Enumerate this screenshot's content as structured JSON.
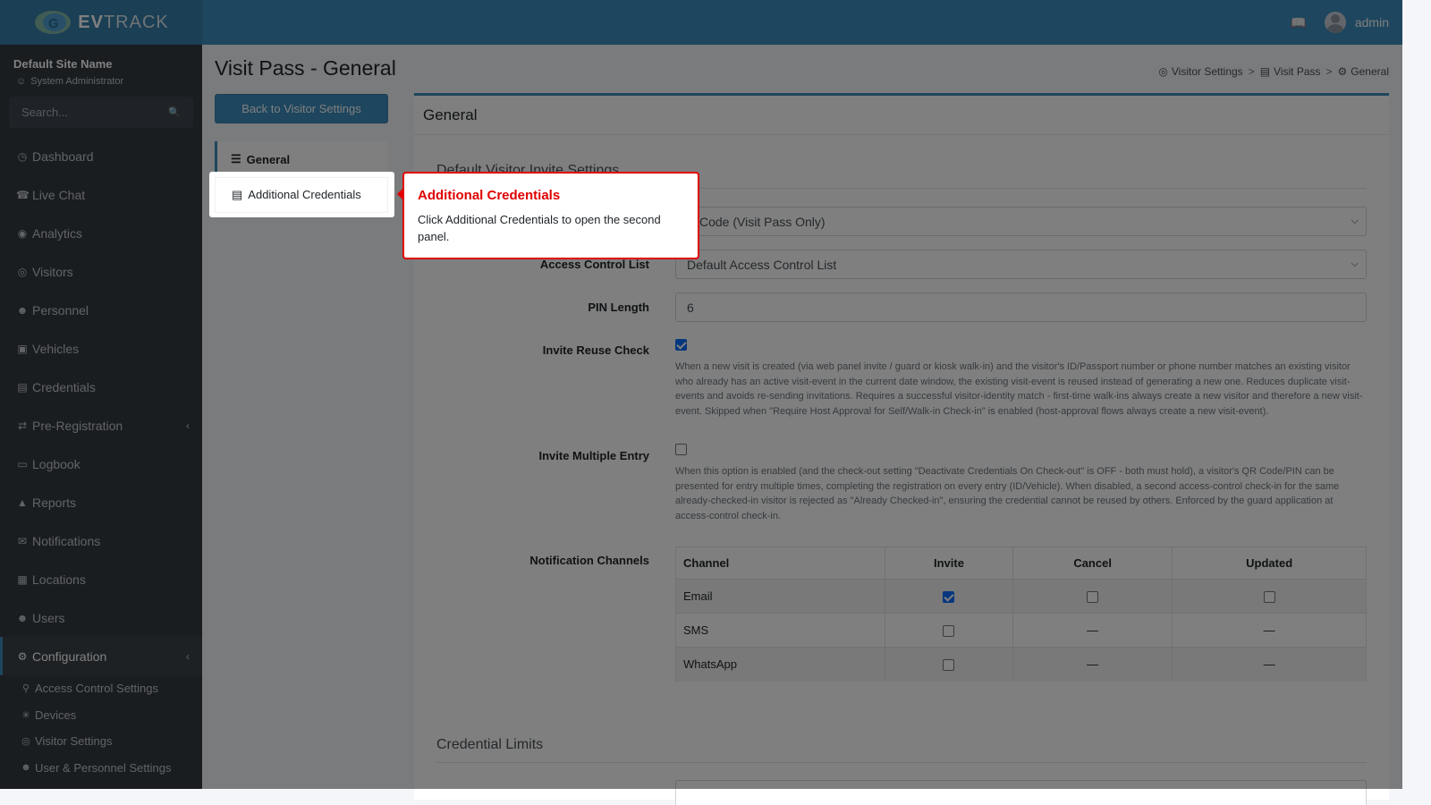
{
  "brand": {
    "name_ev": "EV",
    "name_track": "TRACK"
  },
  "topbar": {
    "user": "admin",
    "icon": "book-icon"
  },
  "sidebar": {
    "site_name": "Default Site Name",
    "role": "System Administrator",
    "search_placeholder": "Search...",
    "items": [
      {
        "label": "Dashboard",
        "icon": "dashboard-icon"
      },
      {
        "label": "Live Chat",
        "icon": "headset-icon"
      },
      {
        "label": "Analytics",
        "icon": "target-icon"
      },
      {
        "label": "Visitors",
        "icon": "eye-icon"
      },
      {
        "label": "Personnel",
        "icon": "personnel-icon"
      },
      {
        "label": "Vehicles",
        "icon": "car-icon"
      },
      {
        "label": "Credentials",
        "icon": "badge-icon"
      },
      {
        "label": "Pre-Registration",
        "icon": "exchange-icon"
      },
      {
        "label": "Logbook",
        "icon": "book-icon"
      },
      {
        "label": "Reports",
        "icon": "report-icon"
      },
      {
        "label": "Notifications",
        "icon": "notification-icon"
      },
      {
        "label": "Locations",
        "icon": "building-icon"
      },
      {
        "label": "Users",
        "icon": "users-icon"
      },
      {
        "label": "Configuration",
        "icon": "gear-icon"
      }
    ],
    "sub_items": [
      {
        "label": "Access Control Settings",
        "icon": "lock-icon"
      },
      {
        "label": "Devices",
        "icon": "device-icon"
      },
      {
        "label": "Visitor Settings",
        "icon": "eye-icon"
      },
      {
        "label": "User & Personnel Settings",
        "icon": "users-icon"
      }
    ]
  },
  "page": {
    "title": "Visit Pass - General",
    "breadcrumb": [
      "Visitor Settings",
      "Visit Pass",
      "General"
    ],
    "back_button": "Back to Visitor Settings",
    "tabs": [
      "General",
      "Additional Credentials"
    ]
  },
  "card": {
    "title": "General",
    "section1": "Default Visitor Invite Settings",
    "credential_type_value": "R Code (Visit Pass Only)",
    "acl_label": "Access Control List",
    "acl_value": "Default Access Control List",
    "pin_label": "PIN Length",
    "pin_value": "6",
    "reuse_label": "Invite Reuse Check",
    "reuse_checked": true,
    "reuse_help": "When a new visit is created (via web panel invite / guard or kiosk walk-in) and the visitor's ID/Passport number or phone number matches an existing visitor who already has an active visit-event in the current date window, the existing visit-event is reused instead of generating a new one. Reduces duplicate visit-events and avoids re-sending invitations. Requires a successful visitor-identity match - first-time walk-ins always create a new visitor and therefore a new visit-event. Skipped when \"Require Host Approval for Self/Walk-in Check-in\" is enabled (host-approval flows always create a new visit-event).",
    "multi_label": "Invite Multiple Entry",
    "multi_checked": false,
    "multi_help": "When this option is enabled (and the check-out setting \"Deactivate Credentials On Check-out\" is OFF - both must hold), a visitor's QR Code/PIN can be presented for entry multiple times, completing the registration on every entry (ID/Vehicle). When disabled, a second access-control check-in for the same already-checked-in visitor is rejected as \"Already Checked-in\", ensuring the credential cannot be reused by others. Enforced by the guard application at access-control check-in.",
    "channels_label": "Notification Channels",
    "channels_headers": [
      "Channel",
      "Invite",
      "Cancel",
      "Updated"
    ],
    "channels": [
      {
        "name": "Email",
        "invite": true,
        "cancel": false,
        "updated": false,
        "dash": ""
      },
      {
        "name": "SMS",
        "invite": false,
        "cancel": null,
        "updated": null,
        "dash": "—"
      },
      {
        "name": "WhatsApp",
        "invite": false,
        "cancel": null,
        "updated": null,
        "dash": "—"
      }
    ],
    "section2": "Credential Limits"
  },
  "tour": {
    "title": "Additional Credentials",
    "body": "Click Additional Credentials to open the second panel."
  },
  "colors": {
    "primary": "#3c8dbc",
    "sidebar": "#343a40",
    "tour_accent": "#e00000"
  }
}
